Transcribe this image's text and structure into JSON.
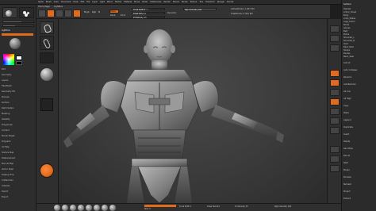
{
  "topbar": {
    "menus": [
      "Alpha",
      "Brush",
      "Color",
      "Document",
      "Draw",
      "Edit",
      "File",
      "Layer",
      "Light",
      "Macro",
      "Marker",
      "Material",
      "Movie",
      "Picker",
      "Preferences",
      "Render",
      "Stencil",
      "Stroke",
      "Texture",
      "Tool",
      "Transform",
      "Zplugin",
      "Zscript"
    ]
  },
  "toolbar": {
    "tab_home": "Home Page",
    "tab_lightbox": "LightBox",
    "edit": "Edit",
    "draw": "Draw",
    "move": "Move",
    "scale": "Scale",
    "rotate": "Rotate",
    "mrgb": "Mrgb",
    "rgb": "Rgb",
    "m": "M",
    "zadd": "Zadd",
    "zsub": "Zsub",
    "zcut": "Zcut",
    "focal_shift": "Focal Shift 0",
    "draw_size": "Draw Size 64",
    "dynamic": "Dynamic",
    "z_intensity": "Z Intensity 25",
    "rgb_intensity": "Rgb Intensity 100",
    "active_points": "ActivePoints: 1.027 Mil",
    "total_points": "TotalPoints: 5.361 Mil"
  },
  "leftpanel": {
    "header": "Lightbox",
    "items": [
      "Quick Sketch",
      "Standard",
      "Move",
      "ClayBuildup",
      "DamStandard",
      "hPolish",
      "Dots",
      "Alpha Off",
      "Texture Off",
      "MatCap Gray",
      "Gradient",
      "SwitchColor",
      "Alternate"
    ],
    "sub_items": [
      "Edit",
      "Geometry",
      "Layers",
      "FiberMesh",
      "Geometry HD",
      "Preview",
      "Surface",
      "Deformation",
      "Masking",
      "Visibility",
      "Polygroups",
      "Contact",
      "Morph Target",
      "Polypaint",
      "UV Map",
      "Texture Map",
      "Displacement",
      "Normal Map",
      "Vector Displ",
      "Display Prop",
      "Unified Skin",
      "Initialize",
      "Import",
      "Export"
    ]
  },
  "rightpanel": {
    "header": "Subtool",
    "items": [
      "Helmet",
      "Armor_Chest",
      "Body",
      "Arms_Plates",
      "Legs_Armor",
      "Boots",
      "Gloves",
      "Belt",
      "Pelvis",
      "Shoulder_L",
      "Shoulder_R",
      "Visor",
      "Back_Pack",
      "Straps",
      "Decals",
      "Neck_Seal"
    ],
    "sub_labels": [
      "List All",
      "Auto Collapse",
      "Rename",
      "AutoReorder",
      "All Low",
      "All High",
      "Copy",
      "Paste",
      "Append",
      "Duplicate",
      "Insert",
      "Delete",
      "Del Other",
      "Del All",
      "Split",
      "Merge",
      "Boolean",
      "Remesh",
      "Project",
      "Extract"
    ]
  },
  "bottombar": {
    "items": [
      "Standard",
      "Move",
      "ClayBuildup",
      "DamStandard",
      "hPolish",
      "Inflate",
      "Pinch",
      "Smooth"
    ],
    "readouts": [
      "SDiv 5",
      "Focal Shift 0",
      "Draw Size 64",
      "Z Intensity 25",
      "Rgb Intensity 100"
    ]
  },
  "colors": {
    "accent": "#e26a1c",
    "bg": "#1e1e1e",
    "viewport": "#3a3a3a"
  }
}
